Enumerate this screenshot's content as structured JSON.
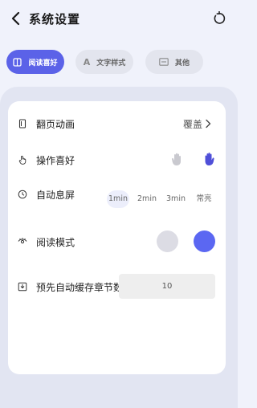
{
  "header": {
    "title": "系统设置",
    "back_icon": "chevron-left-icon",
    "reset_icon": "refresh-icon"
  },
  "tabs": [
    {
      "label": "阅读喜好",
      "icon": "book-icon",
      "active": true
    },
    {
      "label": "文字样式",
      "icon": "font-icon",
      "active": false
    },
    {
      "label": "其他",
      "icon": "keyboard-icon",
      "active": false
    }
  ],
  "settings": {
    "page_animation": {
      "label": "翻页动画",
      "value": "覆盖",
      "icon": "page-icon"
    },
    "operation_pref": {
      "label": "操作喜好",
      "icon": "hand-pointer-icon",
      "options": [
        "left-hand-icon",
        "right-hand-icon"
      ],
      "selected": "right-hand-icon"
    },
    "auto_screen_off": {
      "label": "自动息屏",
      "icon": "clock-icon",
      "options": [
        "1min",
        "2min",
        "3min",
        "常亮"
      ],
      "selected": "1min"
    },
    "reading_mode": {
      "label": "阅读模式",
      "icon": "eye-icon",
      "options": [
        "gray",
        "blue"
      ],
      "selected": "blue"
    },
    "preload_chapters": {
      "label": "预先自动缓存章节数",
      "icon": "download-icon",
      "value": "10"
    }
  },
  "colors": {
    "accent": "#5b62e8",
    "background": "#f0f2fb",
    "panel": "#e2e5f2",
    "mode_gray": "#dcdce4",
    "mode_blue": "#5b67f2"
  }
}
